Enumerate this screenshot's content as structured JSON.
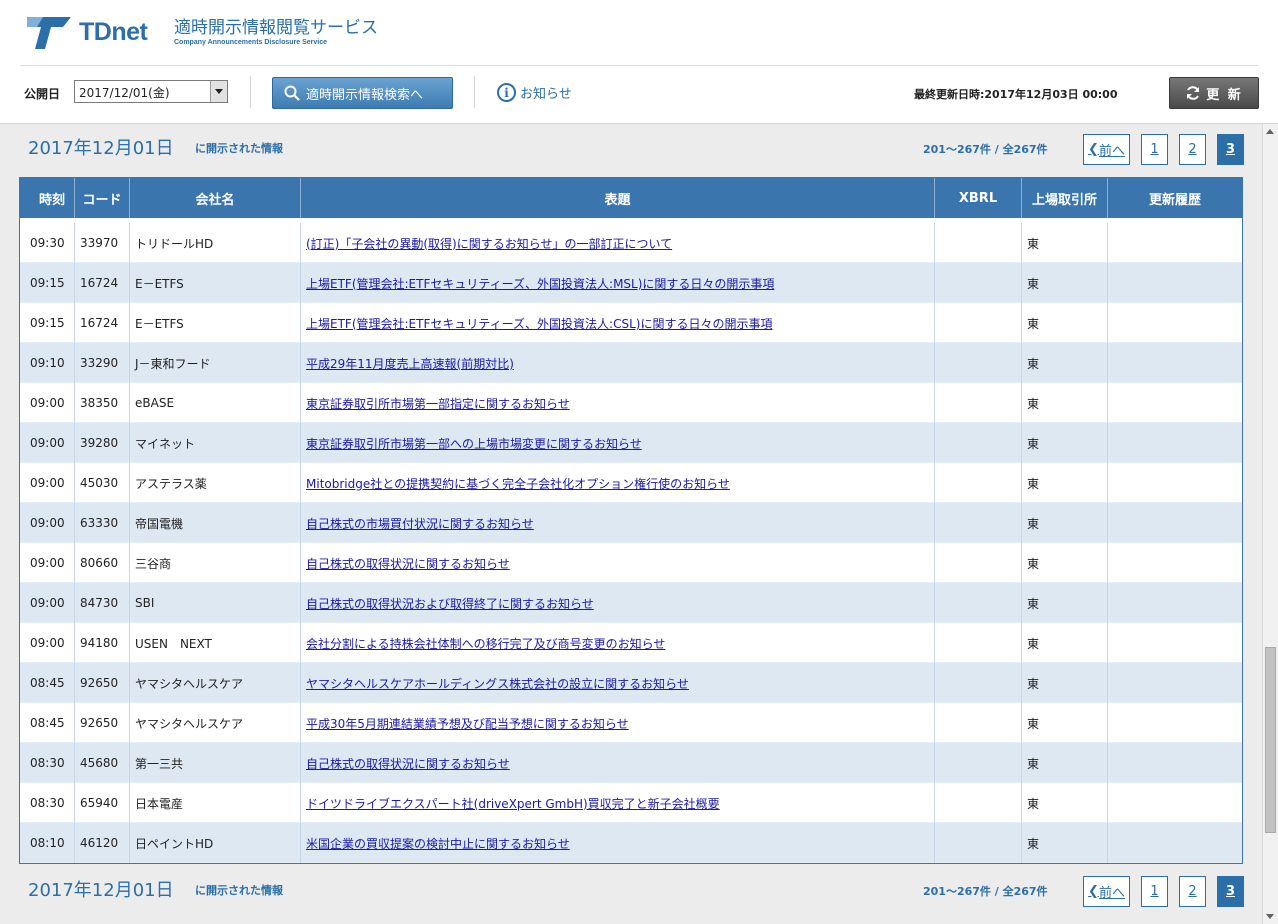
{
  "header": {
    "logo_text": "TDnet",
    "service_title": "適時開示情報閲覧サービス",
    "service_subtitle": "Company Announcements Disclosure Service",
    "pubdate_label": "公開日",
    "pubdate_value": "2017/12/01(金)",
    "search_button": "適時開示情報検索へ",
    "notice_link": "お知らせ",
    "last_update": "最終更新日時:2017年12月03日 00:00",
    "refresh_button": "更 新"
  },
  "section": {
    "date": "2017年12月01日",
    "subtitle": "に開示された情報",
    "range": "201～267件 / 全267件",
    "prev_label": "前へ",
    "pages": [
      "1",
      "2",
      "3"
    ],
    "current_page": "3"
  },
  "table": {
    "headers": [
      "時刻",
      "コード",
      "会社名",
      "表題",
      "XBRL",
      "上場取引所",
      "更新履歴"
    ],
    "rows": [
      {
        "time": "09:30",
        "code": "33970",
        "company": "トリドールHD",
        "title": "(訂正)「子会社の異動(取得)に関するお知らせ」の一部訂正について",
        "xbrl": "",
        "exchange": "東",
        "history": ""
      },
      {
        "time": "09:15",
        "code": "16724",
        "company": "E－ETFS",
        "title": "上場ETF(管理会社:ETFセキュリティーズ、外国投資法人:MSL)に関する日々の開示事項",
        "xbrl": "",
        "exchange": "東",
        "history": ""
      },
      {
        "time": "09:15",
        "code": "16724",
        "company": "E－ETFS",
        "title": "上場ETF(管理会社:ETFセキュリティーズ、外国投資法人:CSL)に関する日々の開示事項",
        "xbrl": "",
        "exchange": "東",
        "history": ""
      },
      {
        "time": "09:10",
        "code": "33290",
        "company": "J－東和フード",
        "title": "平成29年11月度売上高速報(前期対比)",
        "xbrl": "",
        "exchange": "東",
        "history": ""
      },
      {
        "time": "09:00",
        "code": "38350",
        "company": "eBASE",
        "title": "東京証券取引所市場第一部指定に関するお知らせ",
        "xbrl": "",
        "exchange": "東",
        "history": ""
      },
      {
        "time": "09:00",
        "code": "39280",
        "company": "マイネット",
        "title": "東京証券取引所市場第一部への上場市場変更に関するお知らせ",
        "xbrl": "",
        "exchange": "東",
        "history": ""
      },
      {
        "time": "09:00",
        "code": "45030",
        "company": "アステラス薬",
        "title": "Mitobridge社との提携契約に基づく完全子会社化オプション権行使のお知らせ",
        "xbrl": "",
        "exchange": "東",
        "history": ""
      },
      {
        "time": "09:00",
        "code": "63330",
        "company": "帝国電機",
        "title": "自己株式の市場買付状況に関するお知らせ",
        "xbrl": "",
        "exchange": "東",
        "history": ""
      },
      {
        "time": "09:00",
        "code": "80660",
        "company": "三谷商",
        "title": "自己株式の取得状況に関するお知らせ",
        "xbrl": "",
        "exchange": "東",
        "history": ""
      },
      {
        "time": "09:00",
        "code": "84730",
        "company": "SBI",
        "title": "自己株式の取得状況および取得終了に関するお知らせ",
        "xbrl": "",
        "exchange": "東",
        "history": ""
      },
      {
        "time": "09:00",
        "code": "94180",
        "company": "USEN　NEXT",
        "title": "会社分割による持株会社体制への移行完了及び商号変更のお知らせ",
        "xbrl": "",
        "exchange": "東",
        "history": ""
      },
      {
        "time": "08:45",
        "code": "92650",
        "company": "ヤマシタヘルスケア",
        "title": "ヤマシタヘルスケアホールディングス株式会社の設立に関するお知らせ",
        "xbrl": "",
        "exchange": "東",
        "history": ""
      },
      {
        "time": "08:45",
        "code": "92650",
        "company": "ヤマシタヘルスケア",
        "title": "平成30年5月期連結業績予想及び配当予想に関するお知らせ",
        "xbrl": "",
        "exchange": "東",
        "history": ""
      },
      {
        "time": "08:30",
        "code": "45680",
        "company": "第一三共",
        "title": "自己株式の取得状況に関するお知らせ",
        "xbrl": "",
        "exchange": "東",
        "history": ""
      },
      {
        "time": "08:30",
        "code": "65940",
        "company": "日本電産",
        "title": "ドイツドライブエクスパート社(driveXpert GmbH)買収完了と新子会社概要",
        "xbrl": "",
        "exchange": "東",
        "history": ""
      },
      {
        "time": "08:10",
        "code": "46120",
        "company": "日ペイントHD",
        "title": "米国企業の買収提案の検討中止に関するお知らせ",
        "xbrl": "",
        "exchange": "東",
        "history": ""
      }
    ]
  },
  "colors": {
    "accent": "#2c6fa8",
    "table_header": "#3a75ad",
    "row_alt": "#dde8f3",
    "link": "#1a1aa8"
  }
}
